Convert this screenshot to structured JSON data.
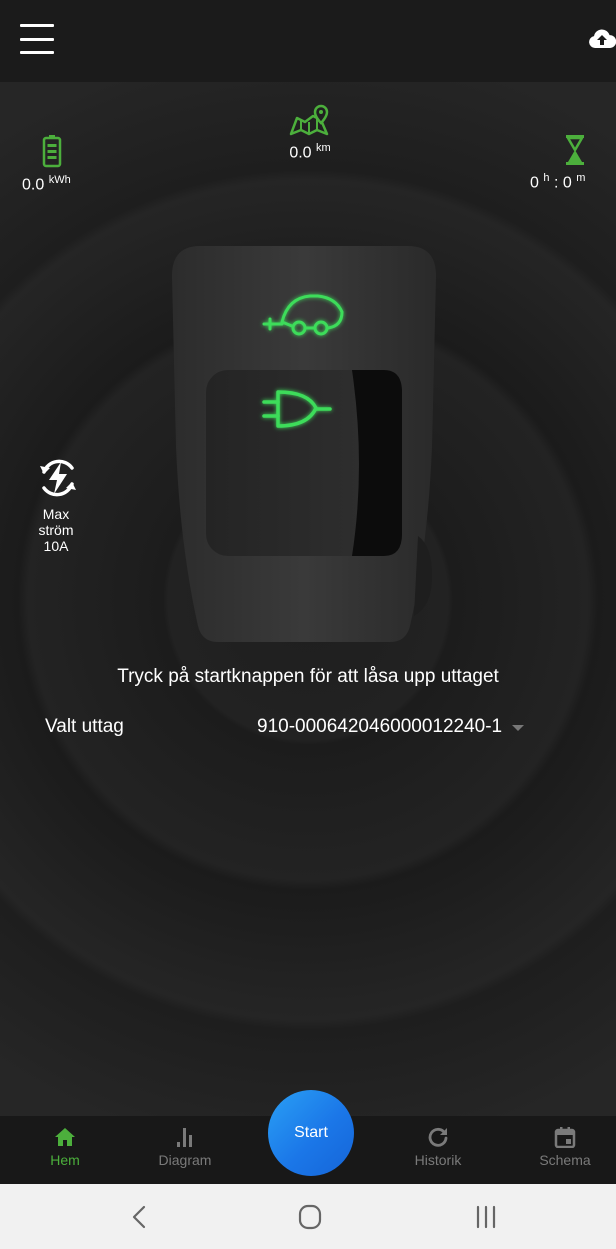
{
  "topbar": {
    "menu_icon": "hamburger-menu-icon",
    "cloud_icon": "cloud-upload-icon"
  },
  "stats": {
    "energy": {
      "value": "0.0",
      "unit": "kWh",
      "icon": "battery-icon"
    },
    "distance": {
      "value": "0.0",
      "unit": "km",
      "icon": "map-pin-icon"
    },
    "time": {
      "hours": "0",
      "hours_unit": "h",
      "separator": ":",
      "minutes": "0",
      "minutes_unit": "m",
      "icon": "hourglass-icon"
    }
  },
  "max_current": {
    "line1": "Max",
    "line2": "ström",
    "line3": "10A",
    "icon": "power-cycle-icon"
  },
  "charger": {
    "car_icon": "electric-car-icon",
    "plug_icon": "plug-icon"
  },
  "instruction": "Tryck på startknappen för att låsa upp uttaget",
  "outlet": {
    "label": "Valt uttag",
    "selected": "910-000642046000012240-1"
  },
  "bottom_nav": {
    "items": [
      {
        "label": "Hem",
        "icon": "home-icon",
        "active": true
      },
      {
        "label": "Diagram",
        "icon": "bar-chart-icon",
        "active": false
      },
      {
        "label": "Historik",
        "icon": "refresh-icon",
        "active": false
      },
      {
        "label": "Schema",
        "icon": "calendar-icon",
        "active": false
      }
    ],
    "start_label": "Start"
  },
  "colors": {
    "accent_green": "#4caf3c",
    "glow_green": "#3ddc5a",
    "start_blue": "#1b77e8",
    "background": "#202020"
  }
}
